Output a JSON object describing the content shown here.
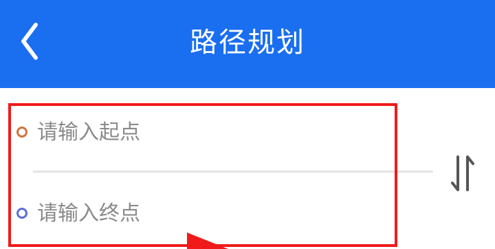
{
  "header": {
    "title": "路径规划",
    "back_icon": "chevron-left-icon",
    "background_color": "#1a6ef0"
  },
  "route_form": {
    "start_placeholder": "请输入起点",
    "end_placeholder": "请输入终点",
    "start_value": "",
    "end_value": "",
    "start_dot_color": "#d0733f",
    "end_dot_color": "#5b6fd6",
    "swap_icon": "swap-vertical-icon"
  },
  "annotation": {
    "highlight_color": "#f01a1a"
  }
}
